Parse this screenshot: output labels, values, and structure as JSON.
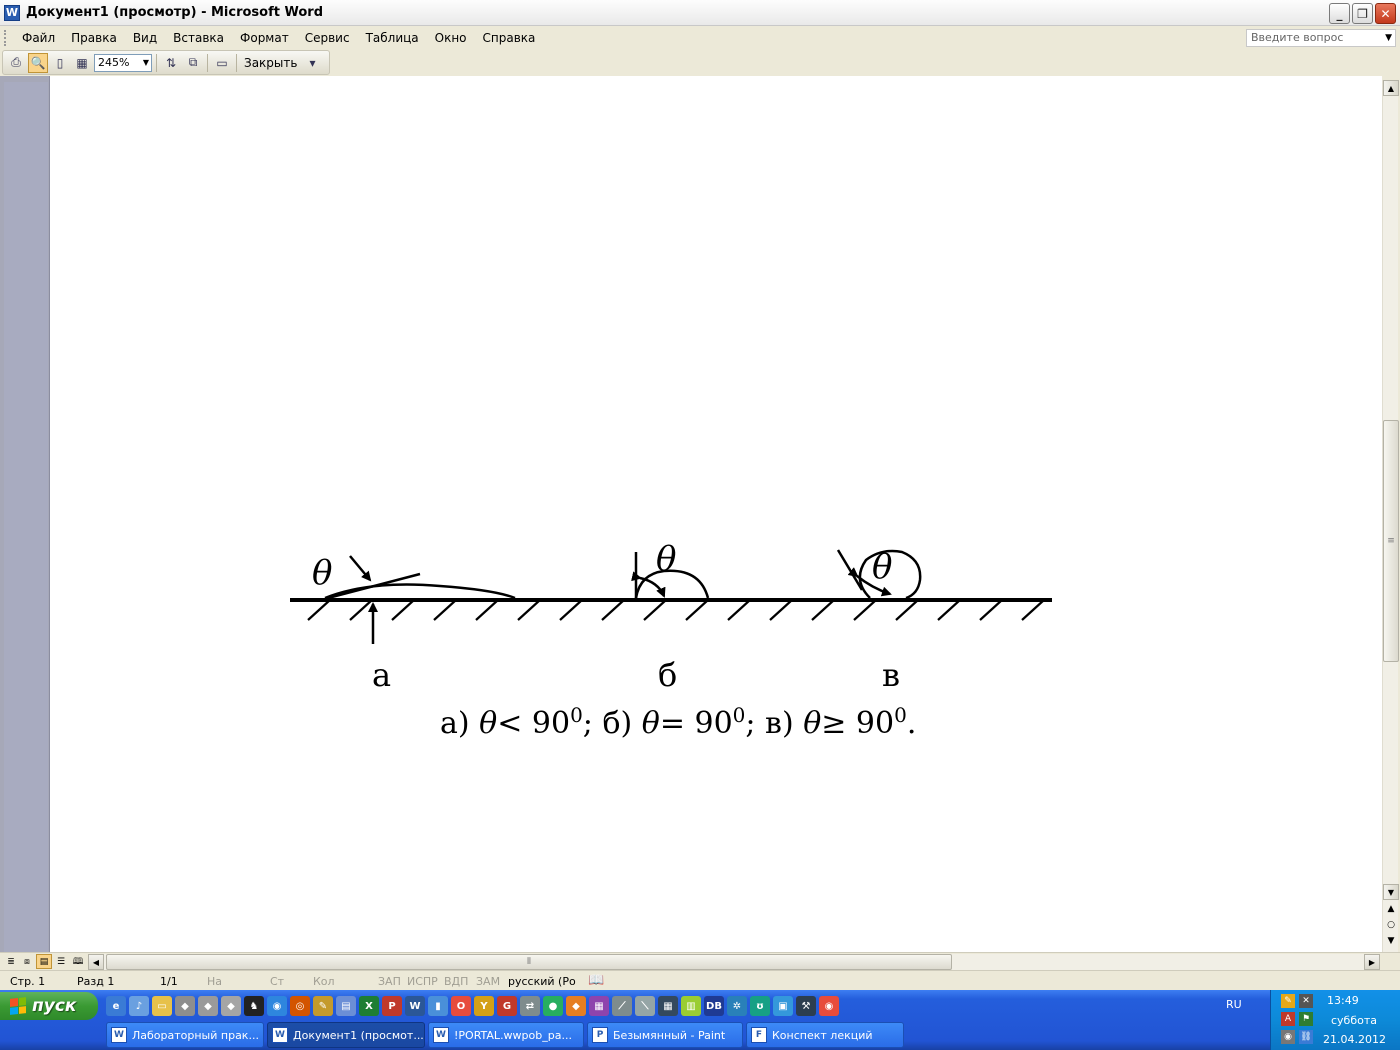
{
  "window": {
    "title": "Документ1 (просмотр) - Microsoft Word",
    "app_icon": "W"
  },
  "menu": {
    "items": [
      "Файл",
      "Правка",
      "Вид",
      "Вставка",
      "Формат",
      "Сервис",
      "Таблица",
      "Окно",
      "Справка"
    ],
    "ask_placeholder": "Введите вопрос"
  },
  "toolbar": {
    "zoom": "245%",
    "close_label": "Закрыть"
  },
  "figure": {
    "theta": "θ",
    "label_a": "а",
    "label_b": "б",
    "label_v": "в",
    "caption": {
      "p1": "а) ",
      "p2": "< 90",
      "p3": "; б) ",
      "p4": "= 90",
      "p5": "; в) ",
      "p6": "≥  90",
      "p7": ".",
      "sup": "0"
    }
  },
  "status": {
    "page": "Стр. 1",
    "section": "Разд 1",
    "pages": "1/1",
    "at": "На",
    "line": "Ст",
    "col": "Кол",
    "rec": "ЗАП",
    "trk": "ИСПР",
    "ext": "ВДП",
    "ovr": "ЗАМ",
    "language": "русский (Ро"
  },
  "taskbar": {
    "start_label": "пуск",
    "language": "RU",
    "tasks": [
      {
        "label": "Лабораторный прак...",
        "icon": "W"
      },
      {
        "label": "Документ1 (просмот...",
        "icon": "W"
      },
      {
        "label": "!PORTAL.wwpob_pa...",
        "icon": "W"
      },
      {
        "label": "Безымянный - Paint",
        "icon": "P"
      },
      {
        "label": "Конспект лекций",
        "icon": "F"
      }
    ],
    "clock": {
      "time": "13:49",
      "day": "суббота",
      "date": "21.04.2012"
    }
  }
}
